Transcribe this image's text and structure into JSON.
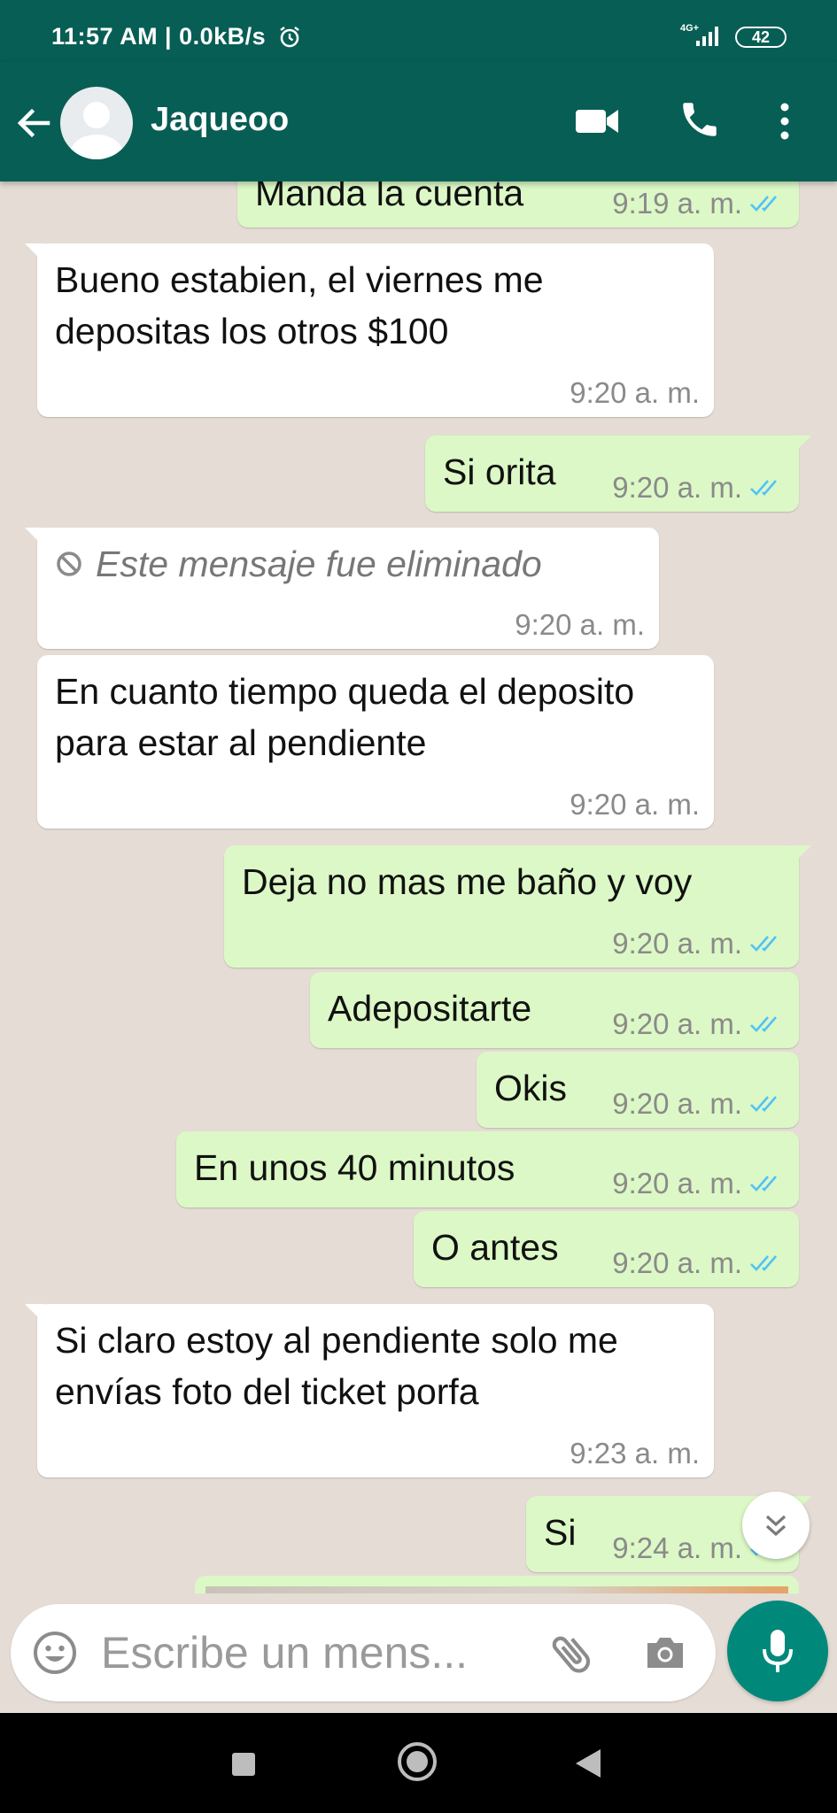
{
  "status_bar": {
    "time": "11:57 AM | 0.0kB/s",
    "network": "4G+",
    "battery": "42"
  },
  "header": {
    "contact_name": "Jaqueoo"
  },
  "messages": [
    {
      "text": "Manda la cuenta",
      "time": "9:19 a. m.",
      "direction": "out",
      "read": true
    },
    {
      "text": "Bueno estabien, el viernes me depositas los otros $100",
      "time": "9:20 a. m.",
      "direction": "in"
    },
    {
      "text": "Si orita",
      "time": "9:20 a. m.",
      "direction": "out",
      "read": true
    },
    {
      "text": "Este mensaje fue eliminado",
      "time": "9:20 a. m.",
      "direction": "in",
      "deleted": true
    },
    {
      "text": "En cuanto tiempo queda el deposito para estar al pendiente",
      "time": "9:20 a. m.",
      "direction": "in"
    },
    {
      "text": "Deja no mas me baño y voy",
      "time": "9:20 a. m.",
      "direction": "out",
      "read": true
    },
    {
      "text": "Adepositarte",
      "time": "9:20 a. m.",
      "direction": "out",
      "read": true
    },
    {
      "text": "Okis",
      "time": "9:20 a. m.",
      "direction": "out",
      "read": true
    },
    {
      "text": "En unos 40 minutos",
      "time": "9:20 a. m.",
      "direction": "out",
      "read": true
    },
    {
      "text": "O antes",
      "time": "9:20 a. m.",
      "direction": "out",
      "read": true
    },
    {
      "text": "Si claro estoy al pendiente solo me envías foto del ticket porfa",
      "time": "9:23 a. m.",
      "direction": "in"
    },
    {
      "text": "Si",
      "time": "9:24 a. m.",
      "direction": "out",
      "read": true
    }
  ],
  "composer": {
    "placeholder": "Escribe un mens..."
  },
  "colors": {
    "header": "#075e54",
    "outgoing_bubble": "#dcf8c6",
    "incoming_bubble": "#ffffff",
    "chat_background": "#e5ddd5",
    "read_ticks": "#4fc3f7",
    "mic_button": "#00897b"
  }
}
